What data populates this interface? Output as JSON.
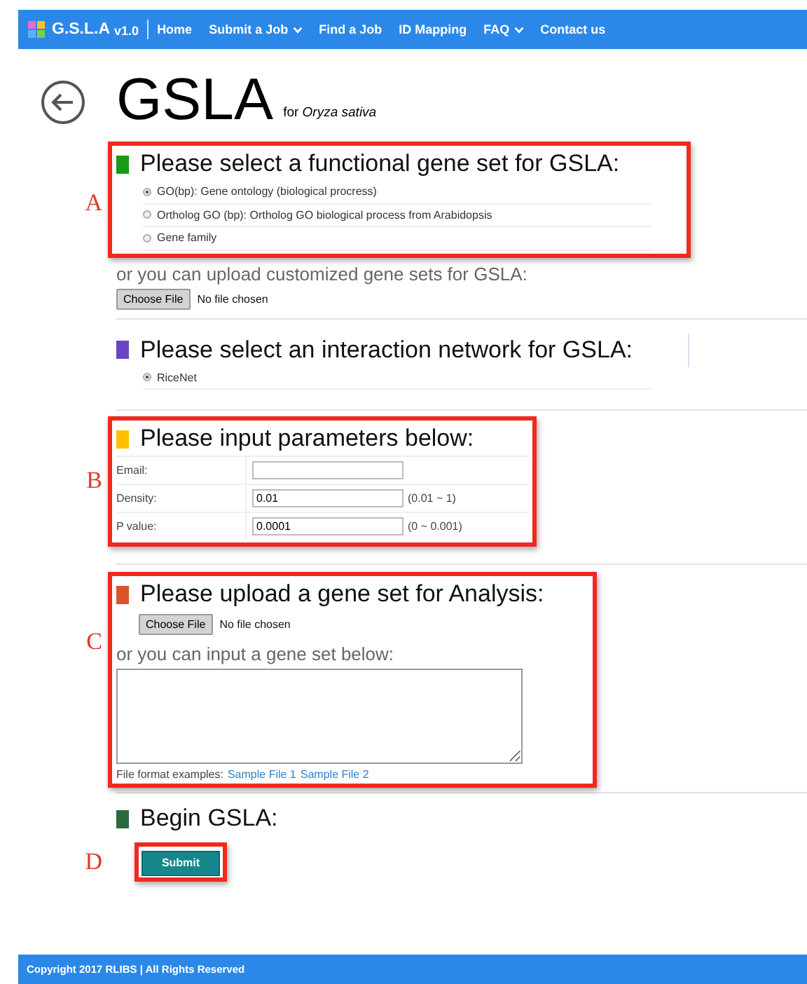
{
  "nav": {
    "brand": "G.S.L.A",
    "version": "v1.0",
    "items": [
      {
        "label": "Home",
        "dropdown": false
      },
      {
        "label": "Submit a Job",
        "dropdown": true
      },
      {
        "label": "Find a Job",
        "dropdown": false
      },
      {
        "label": "ID Mapping",
        "dropdown": false
      },
      {
        "label": "FAQ",
        "dropdown": true
      },
      {
        "label": "Contact us",
        "dropdown": false
      }
    ]
  },
  "header": {
    "title": "GSLA",
    "subtitle": "for *Oryza sativa*"
  },
  "sections": [
    {
      "kind": "choice",
      "marker": "A",
      "color": "#179b18",
      "heading": "Please select a functional gene set for GSLA:",
      "options": [
        {
          "label": "GO(bp): Gene ontology (biological procress)",
          "selected": true
        },
        {
          "label": "Ortholog GO (bp): Ortholog GO biological process from Arabidopsis",
          "selected": false
        },
        {
          "label": "Gene family",
          "selected": false
        }
      ],
      "upload": {
        "prompt": "or you can upload customized gene sets for GSLA:",
        "button": "Choose File",
        "status": "No file chosen"
      }
    },
    {
      "kind": "choice",
      "color": "#6a44c4",
      "heading": "Please select an interaction network for GSLA:",
      "options": [
        {
          "label": "RiceNet",
          "selected": true
        }
      ]
    },
    {
      "kind": "params",
      "marker": "B",
      "color": "#ffc000",
      "heading": "Please input parameters below:",
      "rows": [
        {
          "label": "Email:"
        },
        {
          "label": "Density:",
          "value": "0.01",
          "range": "(0.01 ~ 1)"
        },
        {
          "label": "P value:",
          "value": "0.0001",
          "range": "(0 ~ 0.001)"
        }
      ]
    },
    {
      "kind": "upload",
      "marker": "C",
      "color": "#d9532b",
      "heading": "Please upload a gene set for Analysis:",
      "button": "Choose File",
      "status": "No file chosen",
      "prompt": "or you can input a gene set below:",
      "examples_label": "File format examples:",
      "links": [
        "Sample File 1",
        "Sample File 2"
      ]
    },
    {
      "kind": "submit",
      "marker": "D",
      "color": "#2a6b3b",
      "heading": "Begin GSLA:",
      "button": "Submit"
    }
  ],
  "footer": "Copyright 2017 RLIBS | All Rights Reserved"
}
